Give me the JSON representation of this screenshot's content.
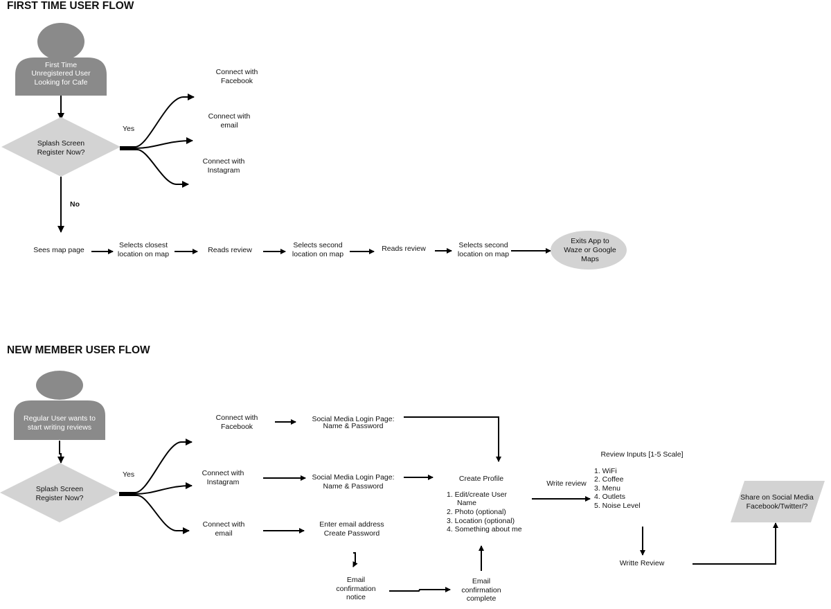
{
  "colors": {
    "person": "#8a8a8a",
    "shape": "#d3d3d3",
    "line": "#000000"
  },
  "flow1": {
    "title": "FIRST TIME USER FLOW",
    "actor": [
      "First Time",
      "Unregistered User",
      "Looking for Cafe"
    ],
    "decision": [
      "Splash Screen",
      "Register Now?"
    ],
    "yes": "Yes",
    "no": "No",
    "options": {
      "facebook": [
        "Connect with",
        "Facebook"
      ],
      "email": [
        "Connect with",
        "email"
      ],
      "instagram": [
        "Connect with",
        "Instagram"
      ]
    },
    "steps": {
      "s1": [
        "Sees map page"
      ],
      "s2": [
        "Selects closest",
        "location on map"
      ],
      "s3": [
        "Reads review"
      ],
      "s4": [
        "Selects second",
        "location on map"
      ],
      "s5": [
        "Reads review"
      ],
      "s6": [
        "Selects second",
        "location on map"
      ]
    },
    "end": [
      "Exits App to",
      "Waze or Google",
      "Maps"
    ]
  },
  "flow2": {
    "title": "NEW MEMBER USER FLOW",
    "actor": [
      "Regular User wants to",
      "start writing reviews"
    ],
    "decision": [
      "Splash Screen",
      "Register Now?"
    ],
    "yes": "Yes",
    "options": {
      "facebook": [
        "Connect with",
        "Facebook"
      ],
      "instagram": [
        "Connect with",
        "Instagram"
      ],
      "email": [
        "Connect with",
        "email"
      ]
    },
    "login_fb": [
      "Social Media Login Page:",
      "Name & Password"
    ],
    "login_ig": [
      "Social Media Login Page:",
      "Name & Password"
    ],
    "email_entry": [
      "Enter email address",
      "Create Password"
    ],
    "email_notice": [
      "Email",
      "confirmation",
      "notice"
    ],
    "email_complete": [
      "Email",
      "confirmation",
      "complete"
    ],
    "profile": {
      "title": "Create Profile",
      "items": [
        "1.   Edit/create User",
        "Name",
        "2.  Photo (optional)",
        "3.  Location (optional)",
        "4.  Something about me"
      ]
    },
    "write_review_label": "Write review",
    "review_inputs": {
      "title": "Review Inputs [1-5 Scale]",
      "items": [
        "1.    WiFi",
        "2.  Coffee",
        "3.  Menu",
        "4.  Outlets",
        "5.  Noise Level"
      ]
    },
    "write_review_step": "Writte Review",
    "share": [
      "Share on Social Media",
      "Facebook/Twitter/?"
    ]
  }
}
